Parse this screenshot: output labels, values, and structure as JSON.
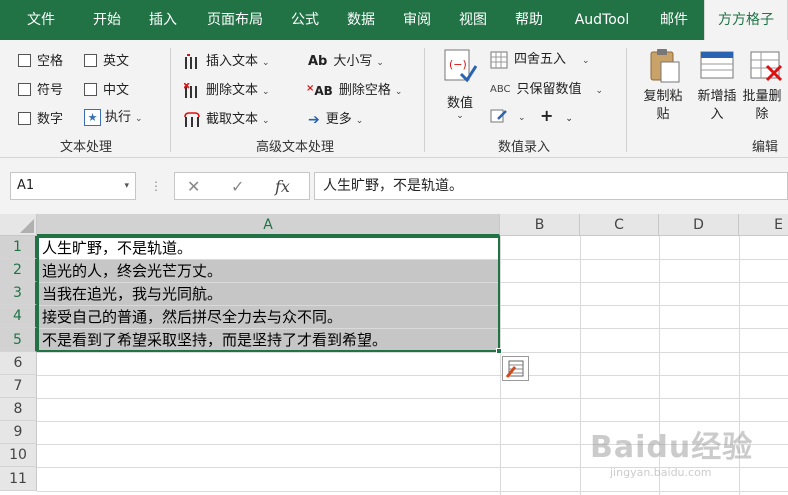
{
  "tabs": [
    {
      "label": "文件"
    },
    {
      "label": "开始"
    },
    {
      "label": "插入"
    },
    {
      "label": "页面布局"
    },
    {
      "label": "公式"
    },
    {
      "label": "数据"
    },
    {
      "label": "审阅"
    },
    {
      "label": "视图"
    },
    {
      "label": "帮助"
    },
    {
      "label": "AudTool"
    },
    {
      "label": "邮件"
    },
    {
      "label": "方方格子"
    }
  ],
  "ribbon": {
    "text_group": {
      "label": "文本处理",
      "space": "空格",
      "english": "英文",
      "symbol": "符号",
      "chinese": "中文",
      "digit": "数字",
      "execute": "执行"
    },
    "adv_group": {
      "label": "高级文本处理",
      "insert_text": "插入文本",
      "delete_text": "删除文本",
      "extract_text": "截取文本",
      "case": "大小写",
      "delete_space": "删除空格",
      "more": "更多"
    },
    "num_group": {
      "label": "数值录入",
      "value": "数值",
      "round": "四舍五入",
      "keep_value": "只保留数值"
    },
    "edit_group": {
      "label": "编辑",
      "copy_paste": "复制粘贴",
      "insert_new": "新增插入",
      "batch_delete": "批量删除"
    }
  },
  "formula_bar": {
    "name_box": "A1",
    "formula": "人生旷野，不是轨道。"
  },
  "grid": {
    "columns": [
      "A",
      "B",
      "C",
      "D",
      "E"
    ],
    "rows": [
      "1",
      "2",
      "3",
      "4",
      "5",
      "6",
      "7",
      "8",
      "9",
      "10",
      "11"
    ],
    "cells": [
      "人生旷野，不是轨道。",
      "追光的人，终会光芒万丈。",
      "当我在追光，我与光同航。",
      "接受自己的普通，然后拼尽全力去与众不同。",
      "不是看到了希望采取坚持，而是坚持了才看到希望。"
    ]
  },
  "watermark": {
    "brand": "Baidu经验",
    "url": "jingyan.baidu.com"
  },
  "colors": {
    "accent": "#217346",
    "highlight": "#c6c6c6"
  }
}
